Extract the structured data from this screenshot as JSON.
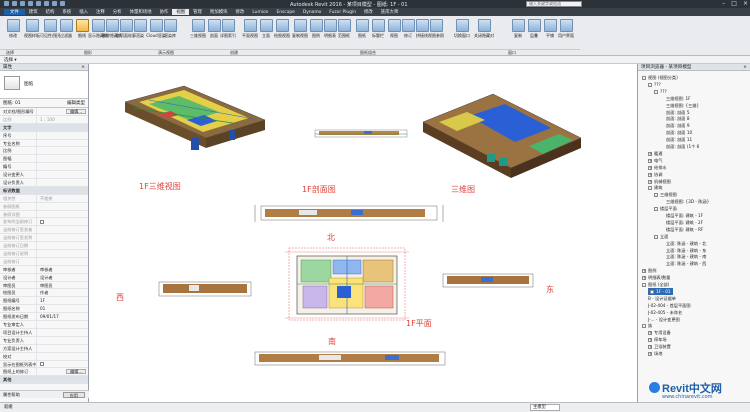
{
  "app": {
    "title": "Autodesk Revit 2016 - 某项目模型 - 图纸: 1F - 01",
    "search_placeholder": "键入关键字或短语"
  },
  "menu": [
    "文件",
    "建筑",
    "结构",
    "系统",
    "插入",
    "注释",
    "分析",
    "体量和场地",
    "协作",
    "视图",
    "管理",
    "附加模块",
    "修改",
    "Lumion",
    "Enscape",
    "Dynamo",
    "Fuzor Plugin",
    "修改",
    "族库大师"
  ],
  "ribbon": {
    "buttons": [
      "修改",
      "视图样板",
      "可见性/图形",
      "过滤器",
      "细线",
      "显示隐藏线",
      "删除隐藏线",
      "剖切面轮廓",
      "渲染",
      "Cloud渲染",
      "渲染库",
      "三维视图",
      "剖面",
      "详图索引",
      "平面视图",
      "立面",
      "绘图视图",
      "复制视图",
      "图例",
      "明细表",
      "范围框",
      "图纸",
      "标题栏",
      "视图",
      "修订",
      "拼接线",
      "视图参照",
      "切换窗口",
      "关闭隐藏对象",
      "复制",
      "层叠",
      "平铺",
      "用户界面"
    ],
    "groups": [
      "选择",
      "图形",
      "演示视图",
      "创建",
      "图纸组合",
      "窗口"
    ]
  },
  "optbar": {
    "label": "选择 ▾"
  },
  "properties": {
    "header": "属性",
    "type_name": "图纸",
    "filter_label": "图纸: 01",
    "edit_type": "编辑类型",
    "rows": [
      {
        "k": "对文档/图形编号",
        "v": "编辑...",
        "btn": true
      },
      {
        "k": "比例",
        "v": "1 : 100",
        "dim": true
      },
      {
        "k": "文字",
        "v": "",
        "sec": true
      },
      {
        "k": "序号",
        "v": ""
      },
      {
        "k": "专业名称",
        "v": ""
      },
      {
        "k": "比例",
        "v": ""
      },
      {
        "k": "图幅",
        "v": ""
      },
      {
        "k": "编号",
        "v": ""
      },
      {
        "k": "设计变更人",
        "v": ""
      },
      {
        "k": "设计负责人",
        "v": ""
      },
      {
        "k": "标识数据",
        "v": "",
        "sec": true
      },
      {
        "k": "相关性",
        "v": "不相关",
        "dim": true
      },
      {
        "k": "参照图纸",
        "v": "",
        "dim": true
      },
      {
        "k": "参照详图",
        "v": "",
        "dim": true
      },
      {
        "k": "发布的当前修订",
        "v": "",
        "dim": true,
        "cb": true
      },
      {
        "k": "当前修订签发者",
        "v": "",
        "dim": true
      },
      {
        "k": "当前修订签发到",
        "v": "",
        "dim": true
      },
      {
        "k": "当前修订日期",
        "v": "",
        "dim": true
      },
      {
        "k": "当前修订说明",
        "v": "",
        "dim": true
      },
      {
        "k": "当前修订",
        "v": "",
        "dim": true
      },
      {
        "k": "审核者",
        "v": "审核者"
      },
      {
        "k": "设计者",
        "v": "设计者"
      },
      {
        "k": "审图员",
        "v": "审图员"
      },
      {
        "k": "绘图员",
        "v": "作者"
      },
      {
        "k": "图纸编号",
        "v": "1F"
      },
      {
        "k": "图纸名称",
        "v": "01"
      },
      {
        "k": "图纸发布日期",
        "v": "09/01/17"
      },
      {
        "k": "专业审定人",
        "v": ""
      },
      {
        "k": "项目设计主持人",
        "v": ""
      },
      {
        "k": "专业负责人",
        "v": ""
      },
      {
        "k": "方案设计主持人",
        "v": ""
      },
      {
        "k": "校对",
        "v": ""
      },
      {
        "k": "显示在图纸列表中",
        "v": "",
        "cb": true
      },
      {
        "k": "图纸上的修订",
        "v": "编辑...",
        "btn": true
      },
      {
        "k": "其他",
        "v": "",
        "sec": true
      }
    ],
    "help": "属性帮助",
    "apply": "应用"
  },
  "canvas": {
    "labels": {
      "iso1": "1F三维视图",
      "section": "1F剖面图",
      "iso2": "三维图",
      "plan": "1F平面",
      "north": "北",
      "south": "南",
      "west": "西",
      "east": "东"
    }
  },
  "browser": {
    "header": "项目浏览器 - 某项目模型",
    "items": [
      {
        "t": "视图 (视图分类)",
        "lvl": 0,
        "tg": "-"
      },
      {
        "t": "???",
        "lvl": 1,
        "tg": "-"
      },
      {
        "t": "???",
        "lvl": 2,
        "tg": "-"
      },
      {
        "t": "三维视图: 1F",
        "lvl": 4
      },
      {
        "t": "三维视图: {三维}",
        "lvl": 4
      },
      {
        "t": "剖面: 剖面 5",
        "lvl": 4
      },
      {
        "t": "剖面: 剖面 8",
        "lvl": 4
      },
      {
        "t": "剖面: 剖面 9",
        "lvl": 4
      },
      {
        "t": "剖面: 剖面 10",
        "lvl": 4
      },
      {
        "t": "剖面: 剖面 11",
        "lvl": 4
      },
      {
        "t": "剖面: 剖面 (1个 6",
        "lvl": 4
      },
      {
        "t": "暖通",
        "lvl": 1,
        "tg": "+"
      },
      {
        "t": "电气",
        "lvl": 1,
        "tg": "+"
      },
      {
        "t": "给排水",
        "lvl": 1,
        "tg": "+"
      },
      {
        "t": "协调",
        "lvl": 1,
        "tg": "+"
      },
      {
        "t": "机械视图",
        "lvl": 1,
        "tg": "+"
      },
      {
        "t": "建筑",
        "lvl": 1,
        "tg": "-"
      },
      {
        "t": "三维视图",
        "lvl": 2,
        "tg": "-"
      },
      {
        "t": "三维视图: {3D - 陈涵}",
        "lvl": 4
      },
      {
        "t": "楼层平面",
        "lvl": 2,
        "tg": "-"
      },
      {
        "t": "楼层平面: 建筑 - 1F",
        "lvl": 4
      },
      {
        "t": "楼层平面: 建筑 - 2F",
        "lvl": 4
      },
      {
        "t": "楼层平面: 建筑 - RF",
        "lvl": 4
      },
      {
        "t": "立面",
        "lvl": 2,
        "tg": "-"
      },
      {
        "t": "立面: 陈涵 - 建筑 - 北",
        "lvl": 4
      },
      {
        "t": "立面: 陈涵 - 建筑 - 东",
        "lvl": 4
      },
      {
        "t": "立面: 陈涵 - 建筑 - 南",
        "lvl": 4
      },
      {
        "t": "立面: 陈涵 - 建筑 - 西",
        "lvl": 4
      },
      {
        "t": "图例",
        "lvl": 0,
        "tg": "+"
      },
      {
        "t": "明细表/数量",
        "lvl": 0,
        "tg": "+"
      },
      {
        "t": "图纸 (全部)",
        "lvl": 0,
        "tg": "-"
      },
      {
        "t": "1F - 01",
        "lvl": 1,
        "tg": "+",
        "hl": true
      },
      {
        "t": "B - 设计证据单",
        "lvl": 1
      },
      {
        "t": "J-02-404 - 首层平面图",
        "lvl": 1
      },
      {
        "t": "J-02-405 - 未命名",
        "lvl": 1
      },
      {
        "t": "J-... - 设计变更图",
        "lvl": 1
      },
      {
        "t": "族",
        "lvl": 0,
        "tg": "-"
      },
      {
        "t": "专用设备",
        "lvl": 1,
        "tg": "+"
      },
      {
        "t": "停车场",
        "lvl": 1,
        "tg": "+"
      },
      {
        "t": "卫浴装置",
        "lvl": 1,
        "tg": "+"
      },
      {
        "t": "场地",
        "lvl": 1,
        "tg": "+"
      }
    ]
  },
  "status": {
    "left": "就绪",
    "model": "主模型"
  },
  "logo": {
    "big": "Revit中文网",
    "small": "www.chinarevit.com"
  }
}
